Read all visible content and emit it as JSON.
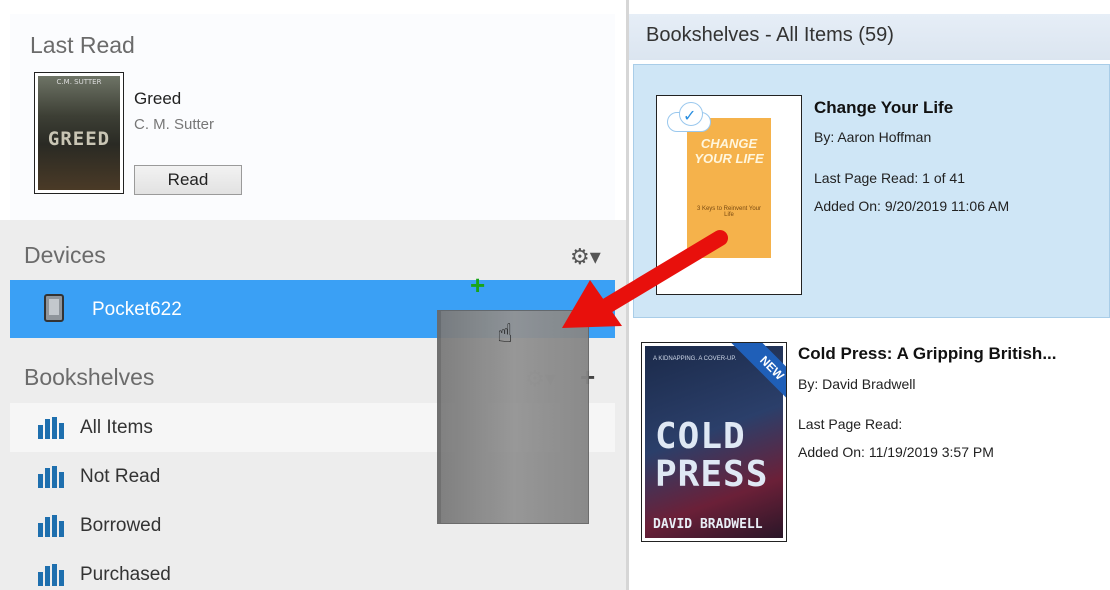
{
  "last_read": {
    "heading": "Last Read",
    "book": {
      "title": "Greed",
      "author": "C. M. Sutter",
      "cover_text": "GREED",
      "cover_top_text": "C.M. SUTTER"
    },
    "read_button": "Read"
  },
  "devices": {
    "heading": "Devices",
    "settings_icon": "gear-icon",
    "items": [
      {
        "name": "Pocket622",
        "icon": "ereader-device-icon",
        "selected": true
      }
    ]
  },
  "bookshelves": {
    "heading": "Bookshelves",
    "settings_icon": "gear-icon",
    "add_icon": "plus-icon",
    "items": [
      {
        "label": "All Items",
        "icon": "bookshelf-icon",
        "selected": true
      },
      {
        "label": "Not Read",
        "icon": "bookshelf-icon",
        "selected": false
      },
      {
        "label": "Borrowed",
        "icon": "bookshelf-icon",
        "selected": false
      },
      {
        "label": "Purchased",
        "icon": "bookshelf-icon",
        "selected": false
      }
    ]
  },
  "main": {
    "title": "Bookshelves - All Items (59)",
    "books": [
      {
        "title": "Change Your Life",
        "by": "By:  Aaron Hoffman",
        "last_page_read": "Last Page Read:  1 of 41",
        "added_on": "Added On:  9/20/2019 11:06 AM",
        "cover_title": "CHANGE YOUR LIFE",
        "cover_subtitle": "3 Keys to Reinvent Your Life",
        "selected": true,
        "cloud_synced": true
      },
      {
        "title": "Cold Press: A Gripping British...",
        "by": "By:  David Bradwell",
        "last_page_read": "Last Page Read:",
        "added_on": "Added On:  11/19/2019 3:57 PM",
        "cover_title_line1": "COLD",
        "cover_title_line2": "PRESS",
        "cover_author": "DAVID BRADWELL",
        "cover_top": "A KIDNAPPING. A COVER-UP.",
        "ribbon": "NEW",
        "selected": false
      }
    ]
  },
  "overlay": {
    "drag_add_icon": "plus-icon",
    "cursor_icon": "hand-pointer-icon",
    "arrow_color": "#e8100c"
  },
  "colors": {
    "selection_blue": "#3aa0f5",
    "selected_book_bg": "#cfe6f6",
    "shelf_icon": "#1e6fae",
    "add_green": "#19a519"
  }
}
